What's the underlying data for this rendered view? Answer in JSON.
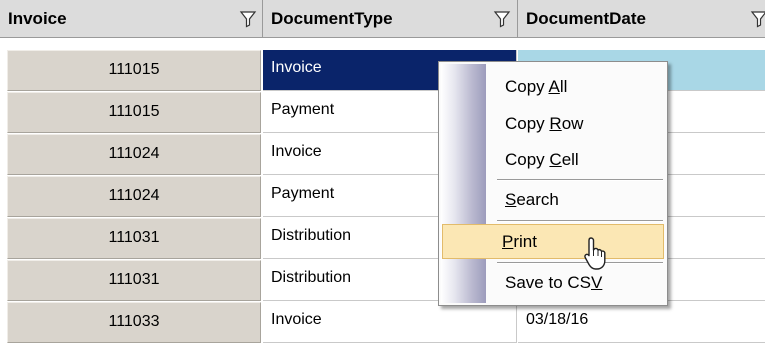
{
  "columns": [
    {
      "label": "Invoice",
      "filter_icon": "filter-icon"
    },
    {
      "label": "DocumentType",
      "filter_icon": "filter-icon"
    },
    {
      "label": "DocumentDate",
      "filter_icon": "filter-icon"
    }
  ],
  "rows": [
    {
      "invoice": "111015",
      "doctype": "Invoice",
      "docdate": ""
    },
    {
      "invoice": "111015",
      "doctype": "Payment",
      "docdate": ""
    },
    {
      "invoice": "111024",
      "doctype": "Invoice",
      "docdate": ""
    },
    {
      "invoice": "111024",
      "doctype": "Payment",
      "docdate": ""
    },
    {
      "invoice": "111031",
      "doctype": "Distribution",
      "docdate": ""
    },
    {
      "invoice": "111031",
      "doctype": "Distribution",
      "docdate": ""
    },
    {
      "invoice": "111033",
      "doctype": "Invoice",
      "docdate": "03/18/16"
    }
  ],
  "selected_row_index": 0,
  "context_menu": {
    "items": [
      {
        "pre": "Copy ",
        "key": "A",
        "post": "ll"
      },
      {
        "pre": "Copy ",
        "key": "R",
        "post": "ow"
      },
      {
        "pre": "Copy ",
        "key": "C",
        "post": "ell"
      },
      {
        "pre": "",
        "key": "S",
        "post": "earch"
      },
      {
        "pre": "",
        "key": "P",
        "post": "rint"
      },
      {
        "pre": "Save to CS",
        "key": "V",
        "post": ""
      }
    ],
    "highlighted_item": "Print"
  },
  "colors": {
    "header_bg": "#dcdcdc",
    "selection_bg": "#0a246a",
    "selection_row_tint": "#a9d7e6",
    "menu_highlight": "#fbe7b4"
  }
}
